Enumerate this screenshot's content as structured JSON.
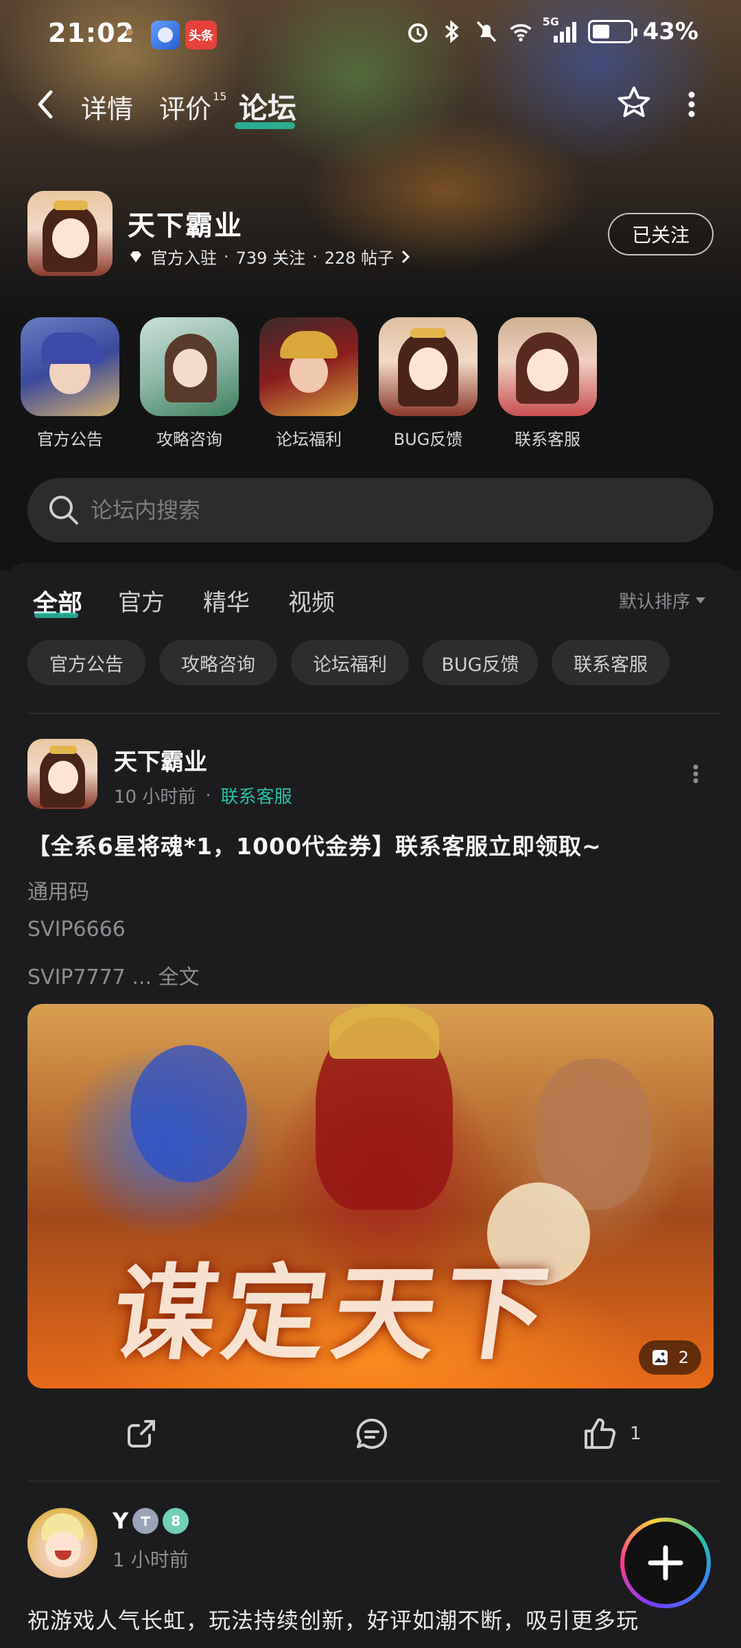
{
  "status_bar": {
    "time": "21:02",
    "notif_app_label": "头条",
    "network": "5G",
    "battery": "43%"
  },
  "nav": {
    "tabs": [
      {
        "label": "详情"
      },
      {
        "label": "评价",
        "count": "15"
      },
      {
        "label": "论坛",
        "active": true
      }
    ]
  },
  "forum": {
    "name": "天下霸业",
    "verified": "官方入驻",
    "followers": "739 关注",
    "posts": "228 帖子",
    "follow_button": "已关注"
  },
  "quick_links": [
    {
      "label": "官方公告",
      "icon": "hero-blue-portrait"
    },
    {
      "label": "攻略咨询",
      "icon": "heroine-green-portrait"
    },
    {
      "label": "论坛福利",
      "icon": "warrior-red-portrait"
    },
    {
      "label": "BUG反馈",
      "icon": "princess-portrait"
    },
    {
      "label": "联系客服",
      "icon": "smiling-heroine-portrait"
    }
  ],
  "search": {
    "placeholder": "论坛内搜索"
  },
  "content_tabs": [
    {
      "label": "全部",
      "active": true
    },
    {
      "label": "官方"
    },
    {
      "label": "精华"
    },
    {
      "label": "视频"
    }
  ],
  "sort": {
    "label": "默认排序"
  },
  "chips": [
    "官方公告",
    "攻略咨询",
    "论坛福利",
    "BUG反馈",
    "联系客服"
  ],
  "posts": [
    {
      "author": "天下霸业",
      "time": "10 小时前",
      "tag": "联系客服",
      "title": "【全系6星将魂*1，1000代金券】联系客服立即领取~",
      "lines": [
        "通用码",
        "SVIP6666",
        "SVIP7777 ... 全文"
      ],
      "image_count": "2",
      "likes": "1"
    },
    {
      "author": "Y",
      "badge_level": "8",
      "time": "1 小时前",
      "text": "祝游戏人气长虹，玩法持续创新，好评如潮不断，吸引更多玩"
    }
  ],
  "colors": {
    "accent": "#27c2a6",
    "background": "#1c1c1e",
    "chip": "#2d2d30"
  }
}
